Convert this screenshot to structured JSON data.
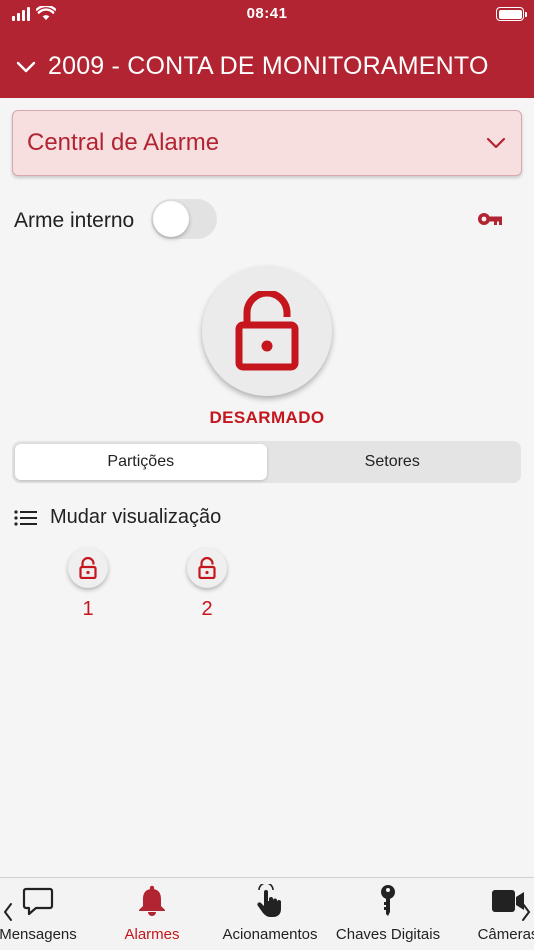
{
  "status_bar": {
    "time": "08:41"
  },
  "header": {
    "title": "2009 - CONTA DE MONITORAMENTO"
  },
  "central": {
    "selected": "Central de Alarme"
  },
  "arme": {
    "label": "Arme interno",
    "enabled": false
  },
  "status": {
    "label": "DESARMADO"
  },
  "segments": {
    "partitions": "Partições",
    "sectors": "Setores"
  },
  "view": {
    "label": "Mudar visualização"
  },
  "partitions": [
    {
      "number": "1"
    },
    {
      "number": "2"
    }
  ],
  "tabs": [
    {
      "label": "Mensagens",
      "icon": "chat-bubble-icon"
    },
    {
      "label": "Alarmes",
      "icon": "bell-icon"
    },
    {
      "label": "Acionamentos",
      "icon": "hand-pointer-icon"
    },
    {
      "label": "Chaves Digitais",
      "icon": "key-icon"
    },
    {
      "label": "Câmeras",
      "icon": "video-camera-icon"
    }
  ],
  "colors": {
    "brand": "#b32432",
    "accent": "#c4161c",
    "dropdown_bg": "#f7dfe0"
  }
}
